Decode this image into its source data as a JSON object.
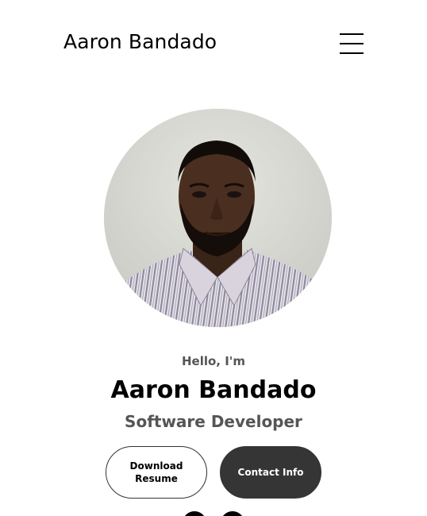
{
  "nav": {
    "logo": "Aaron Bandado",
    "menu_icon": "hamburger-menu-icon"
  },
  "profile": {
    "picture_alt": "Profile picture",
    "greeting": "Hello, I'm",
    "name": "Aaron Bandado",
    "title": "Software Developer"
  },
  "buttons": {
    "resume_label": "Download Resume",
    "contact_label": "Contact Info"
  },
  "socials": {
    "icons": [
      "linkedin-icon",
      "github-icon"
    ]
  },
  "colors": {
    "primary_text": "#000000",
    "secondary_text": "#555555",
    "contact_button_bg": "#353535"
  }
}
